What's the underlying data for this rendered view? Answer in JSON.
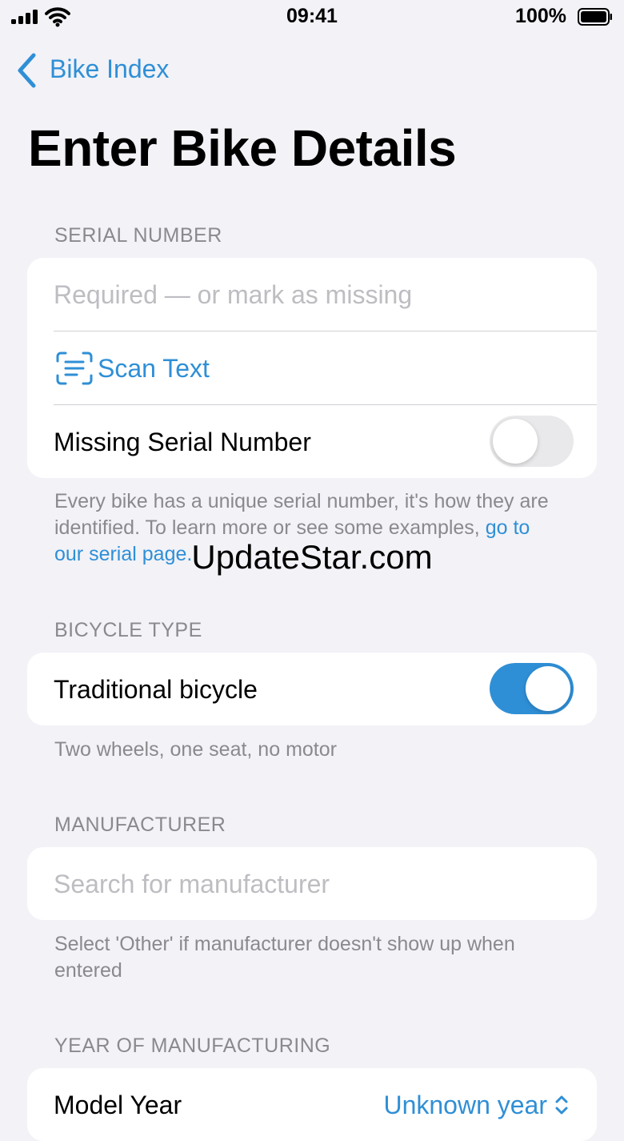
{
  "status_bar": {
    "time": "09:41",
    "battery": "100%"
  },
  "nav": {
    "back_label": "Bike Index"
  },
  "page": {
    "title": "Enter Bike Details"
  },
  "serial_section": {
    "header": "SERIAL NUMBER",
    "input_placeholder": "Required — or mark as missing",
    "scan_label": "Scan Text",
    "missing_label": "Missing Serial Number",
    "missing_toggle": false,
    "footer_prefix": "Every bike has a unique serial number, it's how they are identified. To learn more or see some examples, ",
    "footer_link": "go to our serial page."
  },
  "type_section": {
    "header": "BICYCLE TYPE",
    "label": "Traditional bicycle",
    "toggle": true,
    "footer": "Two wheels, one seat, no motor"
  },
  "manufacturer_section": {
    "header": "MANUFACTURER",
    "placeholder": "Search for manufacturer",
    "footer": "Select 'Other' if manufacturer doesn't show up when entered"
  },
  "year_section": {
    "header": "YEAR OF MANUFACTURING",
    "label": "Model Year",
    "value": "Unknown year"
  },
  "watermark": "UpdateStar.com",
  "colors": {
    "accent": "#2f8fd6",
    "background": "#f2f2f7"
  },
  "icons": [
    "cellular-signal-icon",
    "wifi-icon",
    "battery-icon",
    "chevron-left-icon",
    "scan-text-icon",
    "up-down-chevron-icon"
  ]
}
